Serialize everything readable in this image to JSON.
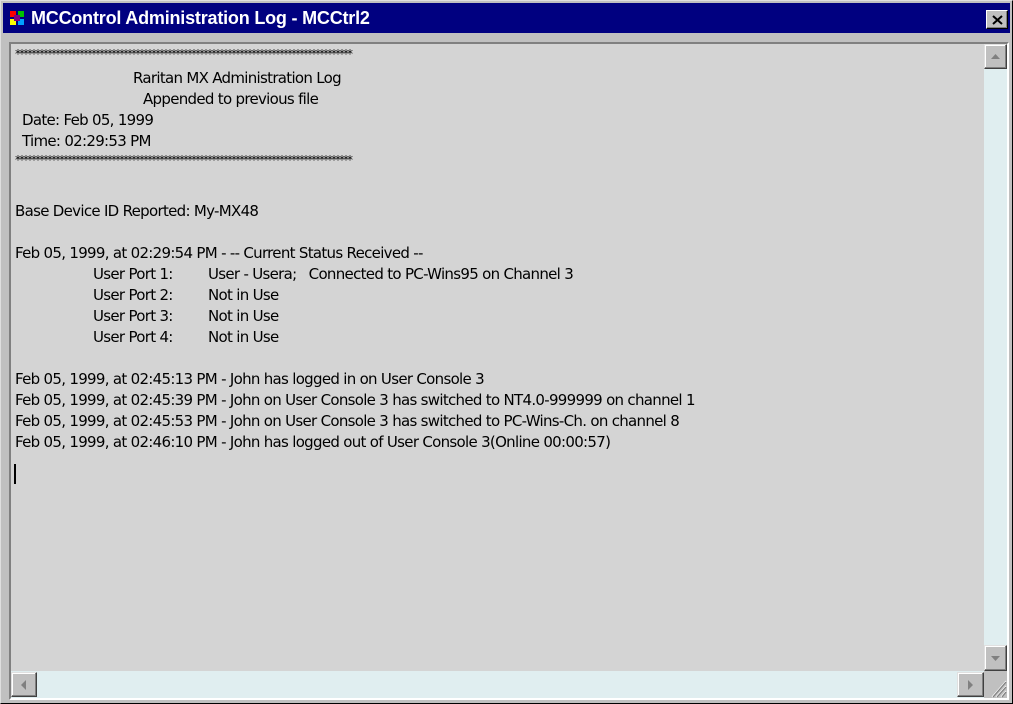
{
  "window": {
    "title": "MCControl Administration Log - MCCtrl2"
  },
  "icons": {
    "app": "app-icon",
    "close": "close-icon",
    "scroll_up": "arrow-up-icon",
    "scroll_down": "arrow-down-icon",
    "scroll_left": "arrow-left-icon",
    "scroll_right": "arrow-right-icon",
    "size_grip": "size-grip-icon"
  },
  "log": {
    "separator_top": "************************************************************************************",
    "header_title": "Raritan MX Administration Log",
    "header_subtitle": "Appended to previous file",
    "date_line": "Date: Feb 05, 1999",
    "time_line": "Time: 02:29:53 PM",
    "separator_bottom": "************************************************************************************",
    "base_device": "Base Device ID Reported: My-MX48",
    "status_line": "Feb 05, 1999, at 02:29:54 PM - -- Current Status Received --",
    "ports": [
      {
        "label": "User Port 1:",
        "status": "User - Usera;   Connected to PC-Wins95 on Channel 3"
      },
      {
        "label": "User Port 2:",
        "status": "Not in Use"
      },
      {
        "label": "User Port 3:",
        "status": "Not in Use"
      },
      {
        "label": "User Port 4:",
        "status": "Not in Use"
      }
    ],
    "events": [
      "Feb 05, 1999, at 02:45:13 PM - John has logged in on User Console 3",
      "Feb 05, 1999, at 02:45:39 PM - John on User Console 3 has switched to NT4.0-999999 on channel 1",
      "Feb 05, 1999, at 02:45:53 PM - John on User Console 3 has switched to PC-Wins-Ch. on channel 8",
      "Feb 05, 1999, at 02:46:10 PM - John has logged out of User Console 3(Online 00:00:57)"
    ]
  },
  "colors": {
    "titlebar": "#000080",
    "text_area": "#d4d4d4",
    "scroll_track": "#e0eef0"
  }
}
